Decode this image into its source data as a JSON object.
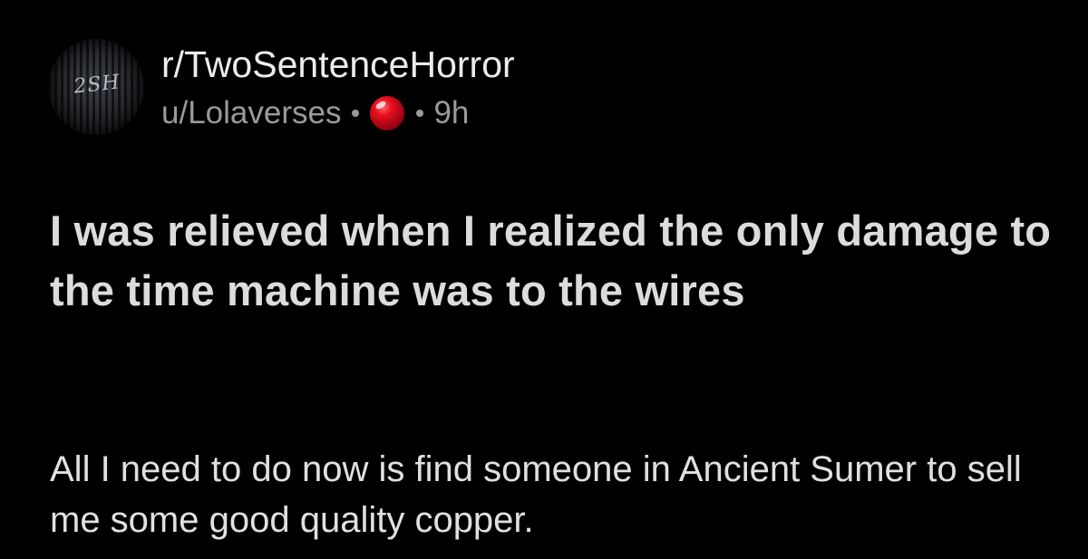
{
  "post": {
    "avatar_text": "2SH",
    "subreddit": "r/TwoSentenceHorror",
    "username": "u/Lolaverses",
    "separator": "•",
    "award_icon": "red-ball-award-icon",
    "award_color": "#e0001b",
    "time_ago": "9h",
    "title": "I was relieved when I realized the only damage to the time machine was to the wires",
    "body": "All I need to do now is find someone in Ancient Sumer to sell me some good quality copper."
  }
}
